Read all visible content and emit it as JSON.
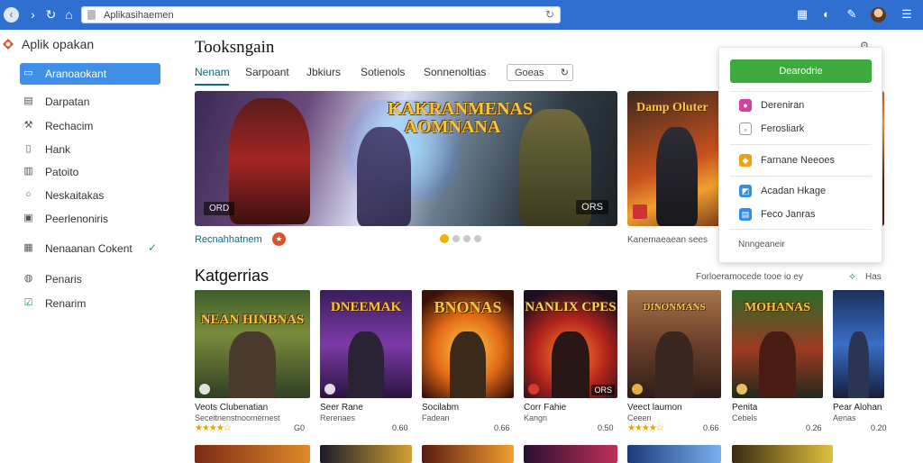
{
  "browser": {
    "url": "Aplikasihaemen",
    "icons": [
      "back-icon",
      "forward-icon",
      "refresh-icon",
      "home-icon",
      "lock-icon",
      "reload-icon",
      "extensions-icon",
      "sync-icon",
      "translate-icon",
      "avatar",
      "menu-icon"
    ]
  },
  "sidebar": {
    "app_title": "Aplik opakan",
    "items": [
      {
        "label": "Aranoaokant",
        "icon": "home-icon",
        "active": true
      },
      {
        "label": "Darpatan",
        "icon": "document-icon"
      },
      {
        "label": "Rechacim",
        "icon": "hammer-icon"
      },
      {
        "label": "Hank",
        "icon": "page-icon"
      },
      {
        "label": "Patoito",
        "icon": "chart-icon"
      },
      {
        "label": "Neskaitakas",
        "icon": "circle-icon"
      },
      {
        "label": "Peerlenoniris",
        "icon": "folder-icon"
      },
      {
        "label": "Nenaanan Cokent",
        "icon": "grid-icon",
        "check": "✓"
      },
      {
        "label": "Penaris",
        "icon": "globe-icon"
      },
      {
        "label": "Renarim",
        "icon": "checkbox-icon"
      }
    ]
  },
  "main": {
    "title": "Tooksngain",
    "tabs": [
      "Nenam",
      "Sarpoant",
      "Jbkiurs",
      "Sotienols",
      "Sonnenoltias"
    ],
    "select_label": "Goeas",
    "hero": {
      "logo": "KAKRANMENAS AOMNANA",
      "badge_left": "ORD",
      "badge_right": "ORS"
    },
    "hero2": {
      "logo": "Damp Oluter"
    },
    "featured_label": "Recnahhatnem",
    "right_caption": "Kanemaeaean sees",
    "section_title": "Katgerrias",
    "section_link": "Forloeramocede tooe io ey",
    "section_more": "Has",
    "cards": [
      {
        "logo": "NEAN HINBNAS",
        "title": "Veots Clubenatian",
        "sub": "Seceitnenstnoomernest",
        "stars": "★★★★☆",
        "price": "G0"
      },
      {
        "logo": "DNEEMAK",
        "title": "Seer Rane",
        "sub": "Rerenaes",
        "price": "0.60"
      },
      {
        "logo": "BNONAS",
        "title": "Socilabm",
        "sub": "Fadean",
        "price": "0.66"
      },
      {
        "logo": "NANLIX CPES",
        "title": "Corr Fahie",
        "sub": "Kangn",
        "price": "0.50"
      },
      {
        "logo": "DINONMANS",
        "title": "Veect laumon",
        "sub": "Ceeen",
        "stars": "★★★★☆",
        "price": "0.66"
      },
      {
        "logo": "MOHANAS",
        "title": "Penita",
        "sub": "Cebels",
        "price": "0.26"
      },
      {
        "logo": "",
        "title": "Pear Alohan",
        "sub": "Aenas",
        "price": "0.20"
      }
    ]
  },
  "popup": {
    "button_label": "Dearodrie",
    "items": [
      "Dereniran",
      "Ferosliark",
      "Farnane Neeoes",
      "Acadan Hkage",
      "Feco Janras"
    ],
    "footer": "Nnngeaneir"
  },
  "colors": {
    "browser_bar": "#2f6fd0",
    "sidebar_active": "#3f8fe6",
    "tab_active": "#0c6a7a",
    "popup_button": "#3caa3c",
    "star": "#e9a400"
  }
}
